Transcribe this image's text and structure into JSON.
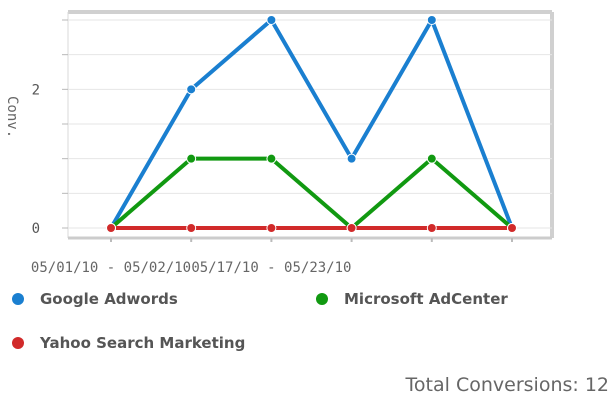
{
  "chart_data": {
    "type": "line",
    "ylabel": "Conv.",
    "ylim": [
      0,
      3
    ],
    "yticks": [
      "0",
      "2"
    ],
    "x_tick_labels": [
      "05/01/10 - 05/02/10",
      "05/17/10 - 05/23/10"
    ],
    "x_points": 6,
    "series": [
      {
        "name": "Google Adwords",
        "color": "#1a7fd0",
        "values": [
          0,
          2,
          3,
          1,
          3,
          0
        ]
      },
      {
        "name": "Microsoft AdCenter",
        "color": "#119911",
        "values": [
          0,
          1,
          1,
          0,
          1,
          0
        ]
      },
      {
        "name": "Yahoo Search Marketing",
        "color": "#d12a2a",
        "values": [
          0,
          0,
          0,
          0,
          0,
          0
        ]
      }
    ],
    "grid": true,
    "legend": "bottom"
  },
  "total": {
    "text": "Total Conversions: 12"
  }
}
